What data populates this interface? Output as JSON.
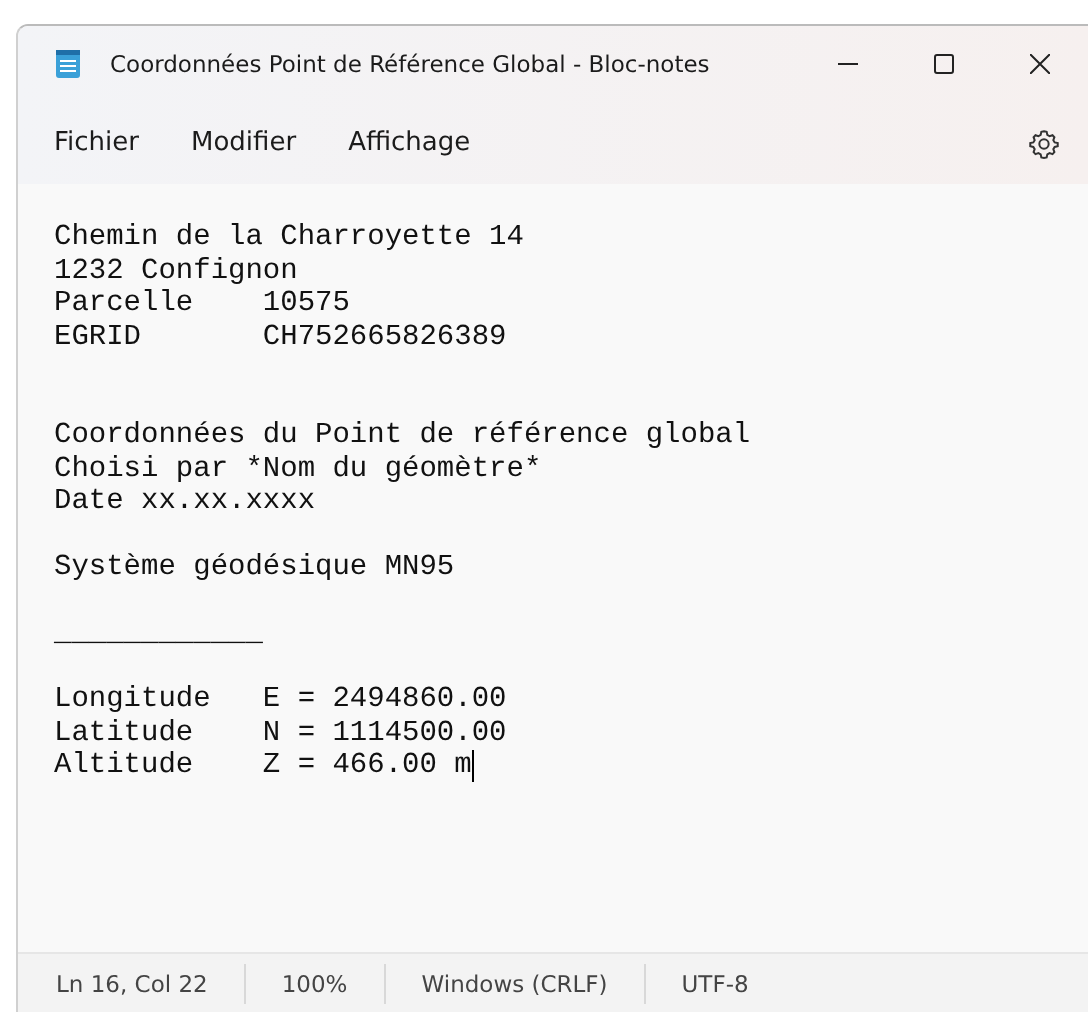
{
  "window": {
    "title": "Coordonnées Point de Référence Global - Bloc-notes"
  },
  "menu": [
    "Fichier",
    "Modifier",
    "Affichage"
  ],
  "lines": [
    {
      "kind": "text",
      "text": "Chemin de la Charroyette 14",
      "cursor": false
    },
    {
      "kind": "text",
      "text": "1232 Confignon",
      "cursor": false
    },
    {
      "kind": "text",
      "text": "Parcelle    10575",
      "cursor": false
    },
    {
      "kind": "text",
      "text": "EGRID       CH752665826389",
      "cursor": false
    },
    {
      "kind": "blank"
    },
    {
      "kind": "blank"
    },
    {
      "kind": "text",
      "text": "Coordonnées du Point de référence global",
      "cursor": false
    },
    {
      "kind": "text",
      "text": "Choisi par *Nom du géomètre*",
      "cursor": false
    },
    {
      "kind": "text",
      "text": "Date xx.xx.xxxx",
      "cursor": false
    },
    {
      "kind": "blank"
    },
    {
      "kind": "text",
      "text": "Système géodésique MN95",
      "cursor": false
    },
    {
      "kind": "blank"
    },
    {
      "kind": "text",
      "text": "____________",
      "cursor": false
    },
    {
      "kind": "blank"
    },
    {
      "kind": "text",
      "text": "Longitude   E = 2494860.00",
      "cursor": false
    },
    {
      "kind": "text",
      "text": "Latitude    N = 1114500.00",
      "cursor": false
    },
    {
      "kind": "text",
      "text": "Altitude    Z = 466.00 m",
      "cursor": true
    }
  ],
  "status_bar": [
    "Ln 16, Col 22",
    "100%",
    "Windows (CRLF)",
    "UTF-8"
  ]
}
